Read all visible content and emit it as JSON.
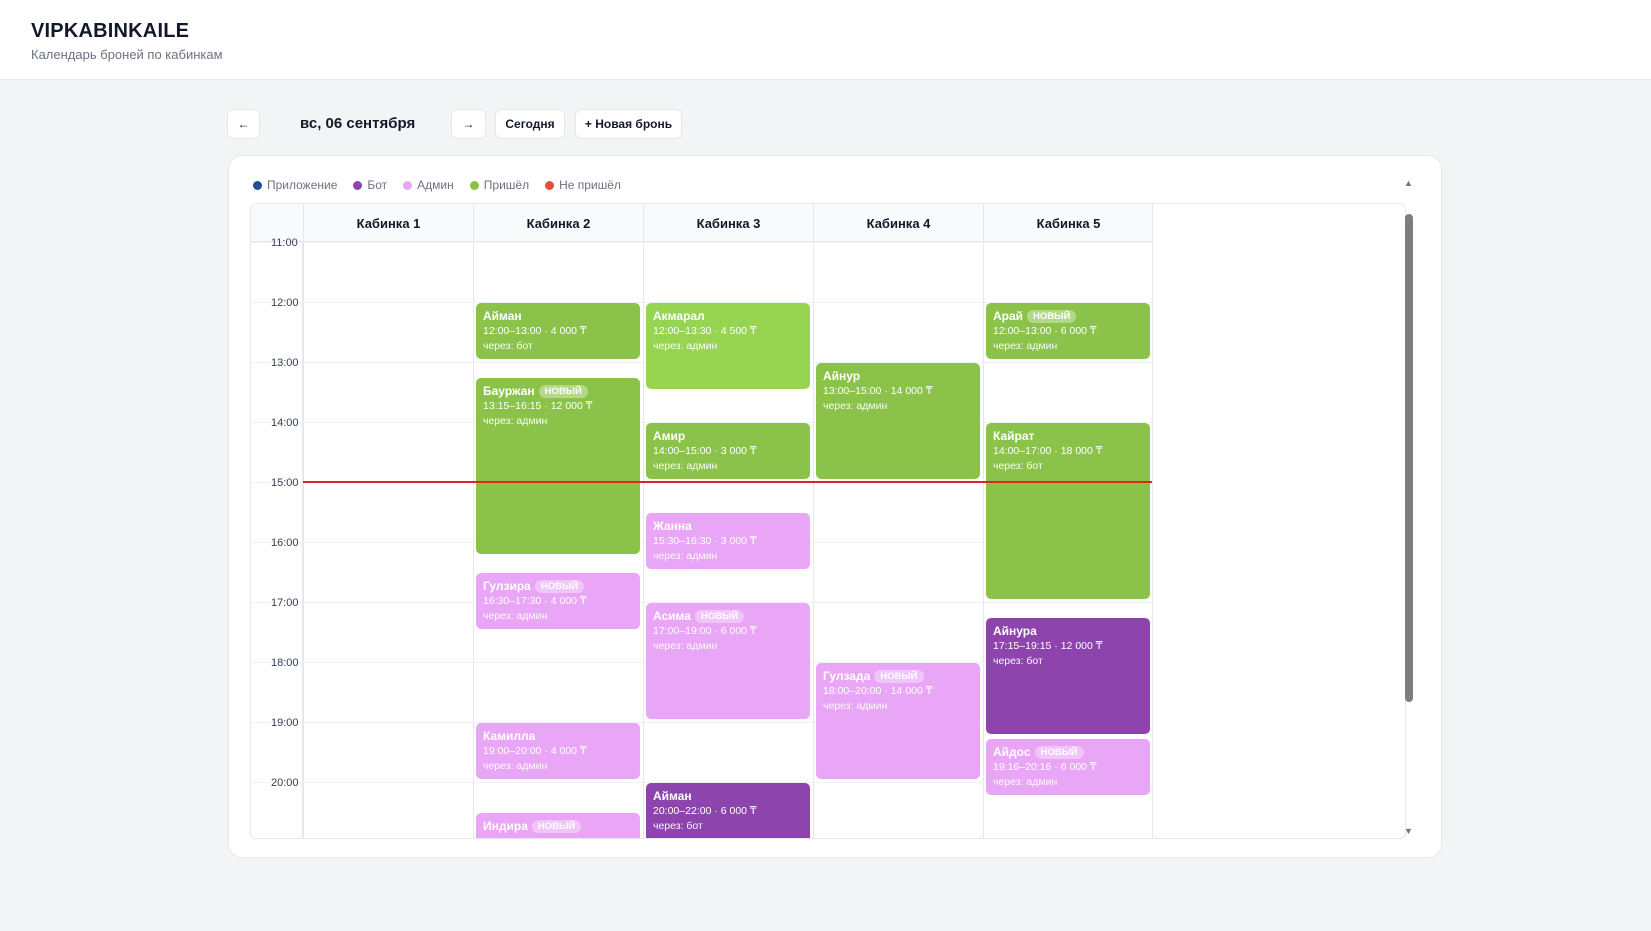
{
  "app": {
    "title": "VIPKABINKAILE",
    "subtitle": "Календарь броней по кабинкам"
  },
  "toolbar": {
    "prev": "←",
    "next": "→",
    "date": "вс, 06 сентября",
    "today": "Сегодня",
    "new_booking": "+ Новая бронь"
  },
  "legend": [
    {
      "label": "Приложение",
      "color": "#1e4f91"
    },
    {
      "label": "Бот",
      "color": "#8e44ad"
    },
    {
      "label": "Админ",
      "color": "#eaa6f6"
    },
    {
      "label": "Пришёл",
      "color": "#8bc34a"
    },
    {
      "label": "Не пришёл",
      "color": "#e74c3c"
    }
  ],
  "cabins": [
    "Кабинка 1",
    "Кабинка 2",
    "Кабинка 3",
    "Кабинка 4",
    "Кабинка 5"
  ],
  "hours": [
    "11:00",
    "12:00",
    "13:00",
    "14:00",
    "15:00",
    "16:00",
    "17:00",
    "18:00",
    "19:00",
    "20:00"
  ],
  "bookings": [
    {
      "name": "Айман",
      "badge": "",
      "meta": "12:00–13:00 · 4 000 ₸",
      "via": "через: бот",
      "color": "green"
    },
    {
      "name": "Бауржан",
      "badge": "НОВЫЙ",
      "meta": "13:15–16:15 · 12 000 ₸",
      "via": "через: админ",
      "color": "green"
    },
    {
      "name": "Гулзира",
      "badge": "НОВЫЙ",
      "meta": "16:30–17:30 · 4 000 ₸",
      "via": "через: админ",
      "color": "pink"
    },
    {
      "name": "Камилла",
      "badge": "",
      "meta": "19:00–20:00 · 4 000 ₸",
      "via": "через: админ",
      "color": "pink"
    },
    {
      "name": "Индира",
      "badge": "НОВЫЙ",
      "meta": "",
      "via": "",
      "color": "pink"
    },
    {
      "name": "Акмарал",
      "badge": "",
      "meta": "12:00–13:30 · 4 500 ₸",
      "via": "через: админ",
      "color": "lgreen"
    },
    {
      "name": "Амир",
      "badge": "",
      "meta": "14:00–15:00 · 3 000 ₸",
      "via": "через: админ",
      "color": "green"
    },
    {
      "name": "Жанна",
      "badge": "",
      "meta": "15:30–16:30 · 3 000 ₸",
      "via": "через: админ",
      "color": "pink"
    },
    {
      "name": "Асима",
      "badge": "НОВЫЙ",
      "meta": "17:00–19:00 · 6 000 ₸",
      "via": "через: админ",
      "color": "pink"
    },
    {
      "name": "Айман",
      "badge": "",
      "meta": "20:00–22:00 · 6 000 ₸",
      "via": "через: бот",
      "color": "purple"
    },
    {
      "name": "Айнур",
      "badge": "",
      "meta": "13:00–15:00 · 14 000 ₸",
      "via": "через: админ",
      "color": "green"
    },
    {
      "name": "Гулзада",
      "badge": "НОВЫЙ",
      "meta": "18:00–20:00 · 14 000 ₸",
      "via": "через: админ",
      "color": "pink"
    },
    {
      "name": "Арай",
      "badge": "НОВЫЙ",
      "meta": "12:00–13:00 · 6 000 ₸",
      "via": "через: админ",
      "color": "green"
    },
    {
      "name": "Кайрат",
      "badge": "",
      "meta": "14:00–17:00 · 18 000 ₸",
      "via": "через: бот",
      "color": "green"
    },
    {
      "name": "Айнура",
      "badge": "",
      "meta": "17:15–19:15 · 12 000 ₸",
      "via": "через: бот",
      "color": "purple"
    },
    {
      "name": "Айдос",
      "badge": "НОВЫЙ",
      "meta": "19:16–20:16 · 6 000 ₸",
      "via": "через: админ",
      "color": "pink"
    }
  ],
  "scroll": {
    "up": "▲",
    "down": "▼"
  }
}
